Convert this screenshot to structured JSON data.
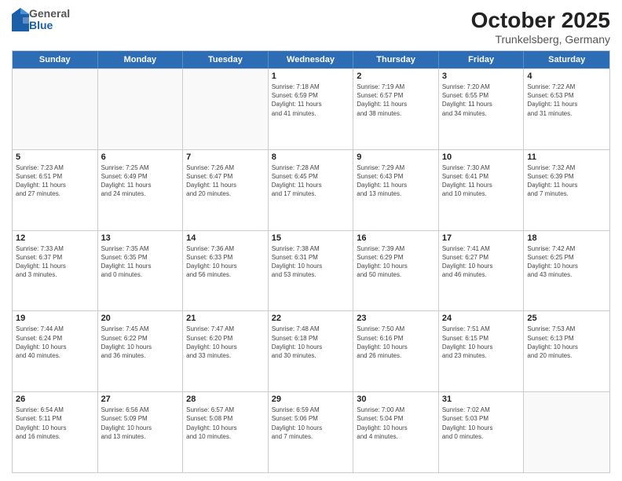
{
  "header": {
    "logo": {
      "general": "General",
      "blue": "Blue"
    },
    "title": "October 2025",
    "subtitle": "Trunkelsberg, Germany"
  },
  "weekdays": [
    "Sunday",
    "Monday",
    "Tuesday",
    "Wednesday",
    "Thursday",
    "Friday",
    "Saturday"
  ],
  "weeks": [
    [
      {
        "day": "",
        "info": ""
      },
      {
        "day": "",
        "info": ""
      },
      {
        "day": "",
        "info": ""
      },
      {
        "day": "1",
        "info": "Sunrise: 7:18 AM\nSunset: 6:59 PM\nDaylight: 11 hours\nand 41 minutes."
      },
      {
        "day": "2",
        "info": "Sunrise: 7:19 AM\nSunset: 6:57 PM\nDaylight: 11 hours\nand 38 minutes."
      },
      {
        "day": "3",
        "info": "Sunrise: 7:20 AM\nSunset: 6:55 PM\nDaylight: 11 hours\nand 34 minutes."
      },
      {
        "day": "4",
        "info": "Sunrise: 7:22 AM\nSunset: 6:53 PM\nDaylight: 11 hours\nand 31 minutes."
      }
    ],
    [
      {
        "day": "5",
        "info": "Sunrise: 7:23 AM\nSunset: 6:51 PM\nDaylight: 11 hours\nand 27 minutes."
      },
      {
        "day": "6",
        "info": "Sunrise: 7:25 AM\nSunset: 6:49 PM\nDaylight: 11 hours\nand 24 minutes."
      },
      {
        "day": "7",
        "info": "Sunrise: 7:26 AM\nSunset: 6:47 PM\nDaylight: 11 hours\nand 20 minutes."
      },
      {
        "day": "8",
        "info": "Sunrise: 7:28 AM\nSunset: 6:45 PM\nDaylight: 11 hours\nand 17 minutes."
      },
      {
        "day": "9",
        "info": "Sunrise: 7:29 AM\nSunset: 6:43 PM\nDaylight: 11 hours\nand 13 minutes."
      },
      {
        "day": "10",
        "info": "Sunrise: 7:30 AM\nSunset: 6:41 PM\nDaylight: 11 hours\nand 10 minutes."
      },
      {
        "day": "11",
        "info": "Sunrise: 7:32 AM\nSunset: 6:39 PM\nDaylight: 11 hours\nand 7 minutes."
      }
    ],
    [
      {
        "day": "12",
        "info": "Sunrise: 7:33 AM\nSunset: 6:37 PM\nDaylight: 11 hours\nand 3 minutes."
      },
      {
        "day": "13",
        "info": "Sunrise: 7:35 AM\nSunset: 6:35 PM\nDaylight: 11 hours\nand 0 minutes."
      },
      {
        "day": "14",
        "info": "Sunrise: 7:36 AM\nSunset: 6:33 PM\nDaylight: 10 hours\nand 56 minutes."
      },
      {
        "day": "15",
        "info": "Sunrise: 7:38 AM\nSunset: 6:31 PM\nDaylight: 10 hours\nand 53 minutes."
      },
      {
        "day": "16",
        "info": "Sunrise: 7:39 AM\nSunset: 6:29 PM\nDaylight: 10 hours\nand 50 minutes."
      },
      {
        "day": "17",
        "info": "Sunrise: 7:41 AM\nSunset: 6:27 PM\nDaylight: 10 hours\nand 46 minutes."
      },
      {
        "day": "18",
        "info": "Sunrise: 7:42 AM\nSunset: 6:25 PM\nDaylight: 10 hours\nand 43 minutes."
      }
    ],
    [
      {
        "day": "19",
        "info": "Sunrise: 7:44 AM\nSunset: 6:24 PM\nDaylight: 10 hours\nand 40 minutes."
      },
      {
        "day": "20",
        "info": "Sunrise: 7:45 AM\nSunset: 6:22 PM\nDaylight: 10 hours\nand 36 minutes."
      },
      {
        "day": "21",
        "info": "Sunrise: 7:47 AM\nSunset: 6:20 PM\nDaylight: 10 hours\nand 33 minutes."
      },
      {
        "day": "22",
        "info": "Sunrise: 7:48 AM\nSunset: 6:18 PM\nDaylight: 10 hours\nand 30 minutes."
      },
      {
        "day": "23",
        "info": "Sunrise: 7:50 AM\nSunset: 6:16 PM\nDaylight: 10 hours\nand 26 minutes."
      },
      {
        "day": "24",
        "info": "Sunrise: 7:51 AM\nSunset: 6:15 PM\nDaylight: 10 hours\nand 23 minutes."
      },
      {
        "day": "25",
        "info": "Sunrise: 7:53 AM\nSunset: 6:13 PM\nDaylight: 10 hours\nand 20 minutes."
      }
    ],
    [
      {
        "day": "26",
        "info": "Sunrise: 6:54 AM\nSunset: 5:11 PM\nDaylight: 10 hours\nand 16 minutes."
      },
      {
        "day": "27",
        "info": "Sunrise: 6:56 AM\nSunset: 5:09 PM\nDaylight: 10 hours\nand 13 minutes."
      },
      {
        "day": "28",
        "info": "Sunrise: 6:57 AM\nSunset: 5:08 PM\nDaylight: 10 hours\nand 10 minutes."
      },
      {
        "day": "29",
        "info": "Sunrise: 6:59 AM\nSunset: 5:06 PM\nDaylight: 10 hours\nand 7 minutes."
      },
      {
        "day": "30",
        "info": "Sunrise: 7:00 AM\nSunset: 5:04 PM\nDaylight: 10 hours\nand 4 minutes."
      },
      {
        "day": "31",
        "info": "Sunrise: 7:02 AM\nSunset: 5:03 PM\nDaylight: 10 hours\nand 0 minutes."
      },
      {
        "day": "",
        "info": ""
      }
    ]
  ]
}
